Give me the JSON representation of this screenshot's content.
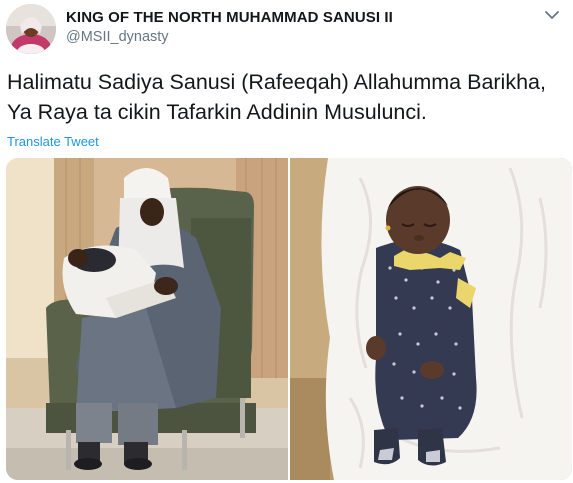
{
  "author": {
    "name": "KING OF THE NORTH MUHAMMAD SANUSI II",
    "handle": "@MSII_dynasty"
  },
  "tweet": {
    "line1": "Halimatu Sadiya Sanusi (Rafeeqah) Allahumma Barikha,",
    "line2": "Ya Raya ta cikin Tafarkin Addinin Musulunci.",
    "translate_label": "Translate Tweet"
  },
  "icons": {
    "caret": "chevron-down-icon"
  },
  "colors": {
    "link": "#1b95e0",
    "secondary_text": "#657786",
    "primary_text": "#14171a"
  }
}
